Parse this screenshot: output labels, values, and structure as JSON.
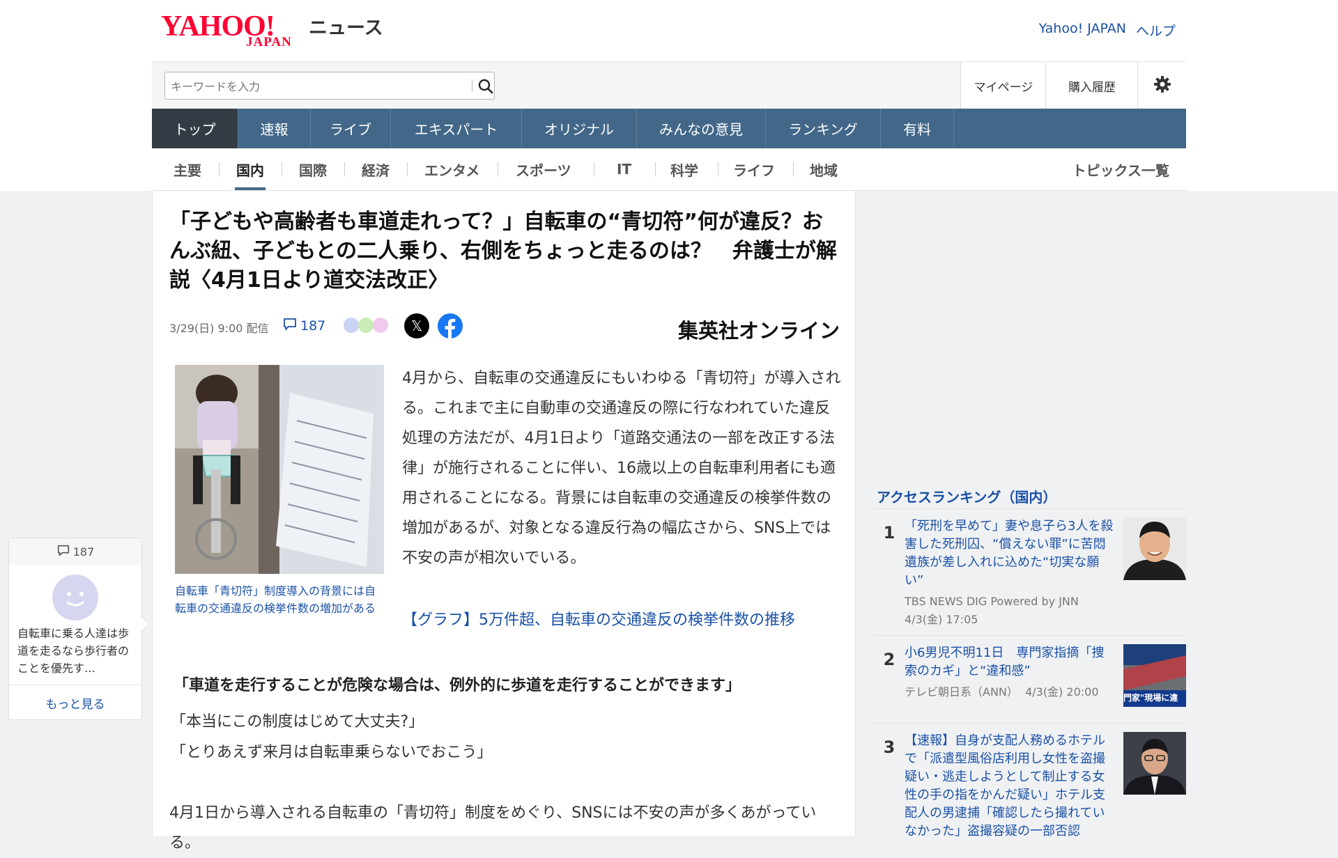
{
  "header": {
    "logo_main": "YAHOO!",
    "logo_sub": "JAPAN",
    "logo_service": "ニュース",
    "links": [
      "Yahoo! JAPAN",
      "ヘルプ"
    ]
  },
  "search": {
    "placeholder": "キーワードを入力",
    "mypage_label": "マイページ",
    "purchase_label": "購入履歴"
  },
  "main_nav": [
    "トップ",
    "速報",
    "ライブ",
    "エキスパート",
    "オリジナル",
    "みんなの意見",
    "ランキング",
    "有料"
  ],
  "sub_nav": [
    "主要",
    "国内",
    "国際",
    "経済",
    "エンタメ",
    "スポーツ",
    "IT",
    "科学",
    "ライフ",
    "地域"
  ],
  "sub_nav_active": "国内",
  "topics_label": "トピックス一覧",
  "article": {
    "title": "「子どもや高齢者も車道走れって？」自転車の“青切符”何が違反？おんぶ紐、子どもとの二人乗り、右側をちょっと走るのは？　弁護士が解説〈4月1日より道交法改正〉",
    "date": "3/29(日) 9:00 配信",
    "comment_count": "187",
    "publisher": "集英社オンライン",
    "caption": "自転車「青切符」制度導入の背景には自転車の交通違反の検挙件数の増加がある",
    "body1": "4月から、自転車の交通違反にもいわゆる「青切符」が導入される。これまで主に自動車の交通違反の際に行なわれていた違反処理の方法だが、4月1日より「道路交通法の一部を改正する法律」が施行されることに伴い、16歳以上の自転車利用者にも適用されることになる。背景には自転車の交通違反の検挙件数の増加があるが、対象となる違反行為の幅広さから、SNS上では不安の声が相次いでいる。",
    "graph_link": "【グラフ】5万件超、自転車の交通違反の検挙件数の推移",
    "subhead": "「車道を走行することが危険な場合は、例外的に歩道を走行することができます」",
    "quote1": "「本当にこの制度はじめて大丈夫?」",
    "quote2": "「とりあえず来月は自転車乗らないでおこう」",
    "body2": "4月1日から導入される自転車の「青切符」制度をめぐり、SNSには不安の声が多くあがっている。"
  },
  "comment_widget": {
    "count": "187",
    "text": "自転車に乗る人達は歩道を走るなら歩行者のことを優先す…",
    "more_label": "もっと見る"
  },
  "ranking": {
    "title": "アクセスランキング（国内）",
    "items": [
      {
        "rank": "1",
        "title": "「死刑を早めて」妻や息子ら3人を殺害した死刑囚、“償えない罪”に苦悶　遺族が差し入れに込めた“切実な願い”",
        "source": "TBS NEWS DIG Powered by JNN",
        "time": "4/3(金) 17:05"
      },
      {
        "rank": "2",
        "title": "小6男児不明11日　専門家指摘「捜索のカギ」と“違和感”",
        "source": "テレビ朝日系（ANN）",
        "time": "4/3(金) 20:00",
        "thumb_text": "門家\"現場に違"
      },
      {
        "rank": "3",
        "title": "【速報】自身が支配人務めるホテルで「派遣型風俗店利用し女性を盗撮疑い・逃走しようとして制止する女性の手の指をかんだ疑い」ホテル支配人の男逮捕「確認したら撮れていなかった」盗撮容疑の一部否認",
        "source": "",
        "time": ""
      }
    ]
  },
  "colors": {
    "brand_red": "#ff0033",
    "nav_blue": "#426789",
    "nav_active": "#333c45",
    "link_blue": "#1a51a6"
  }
}
